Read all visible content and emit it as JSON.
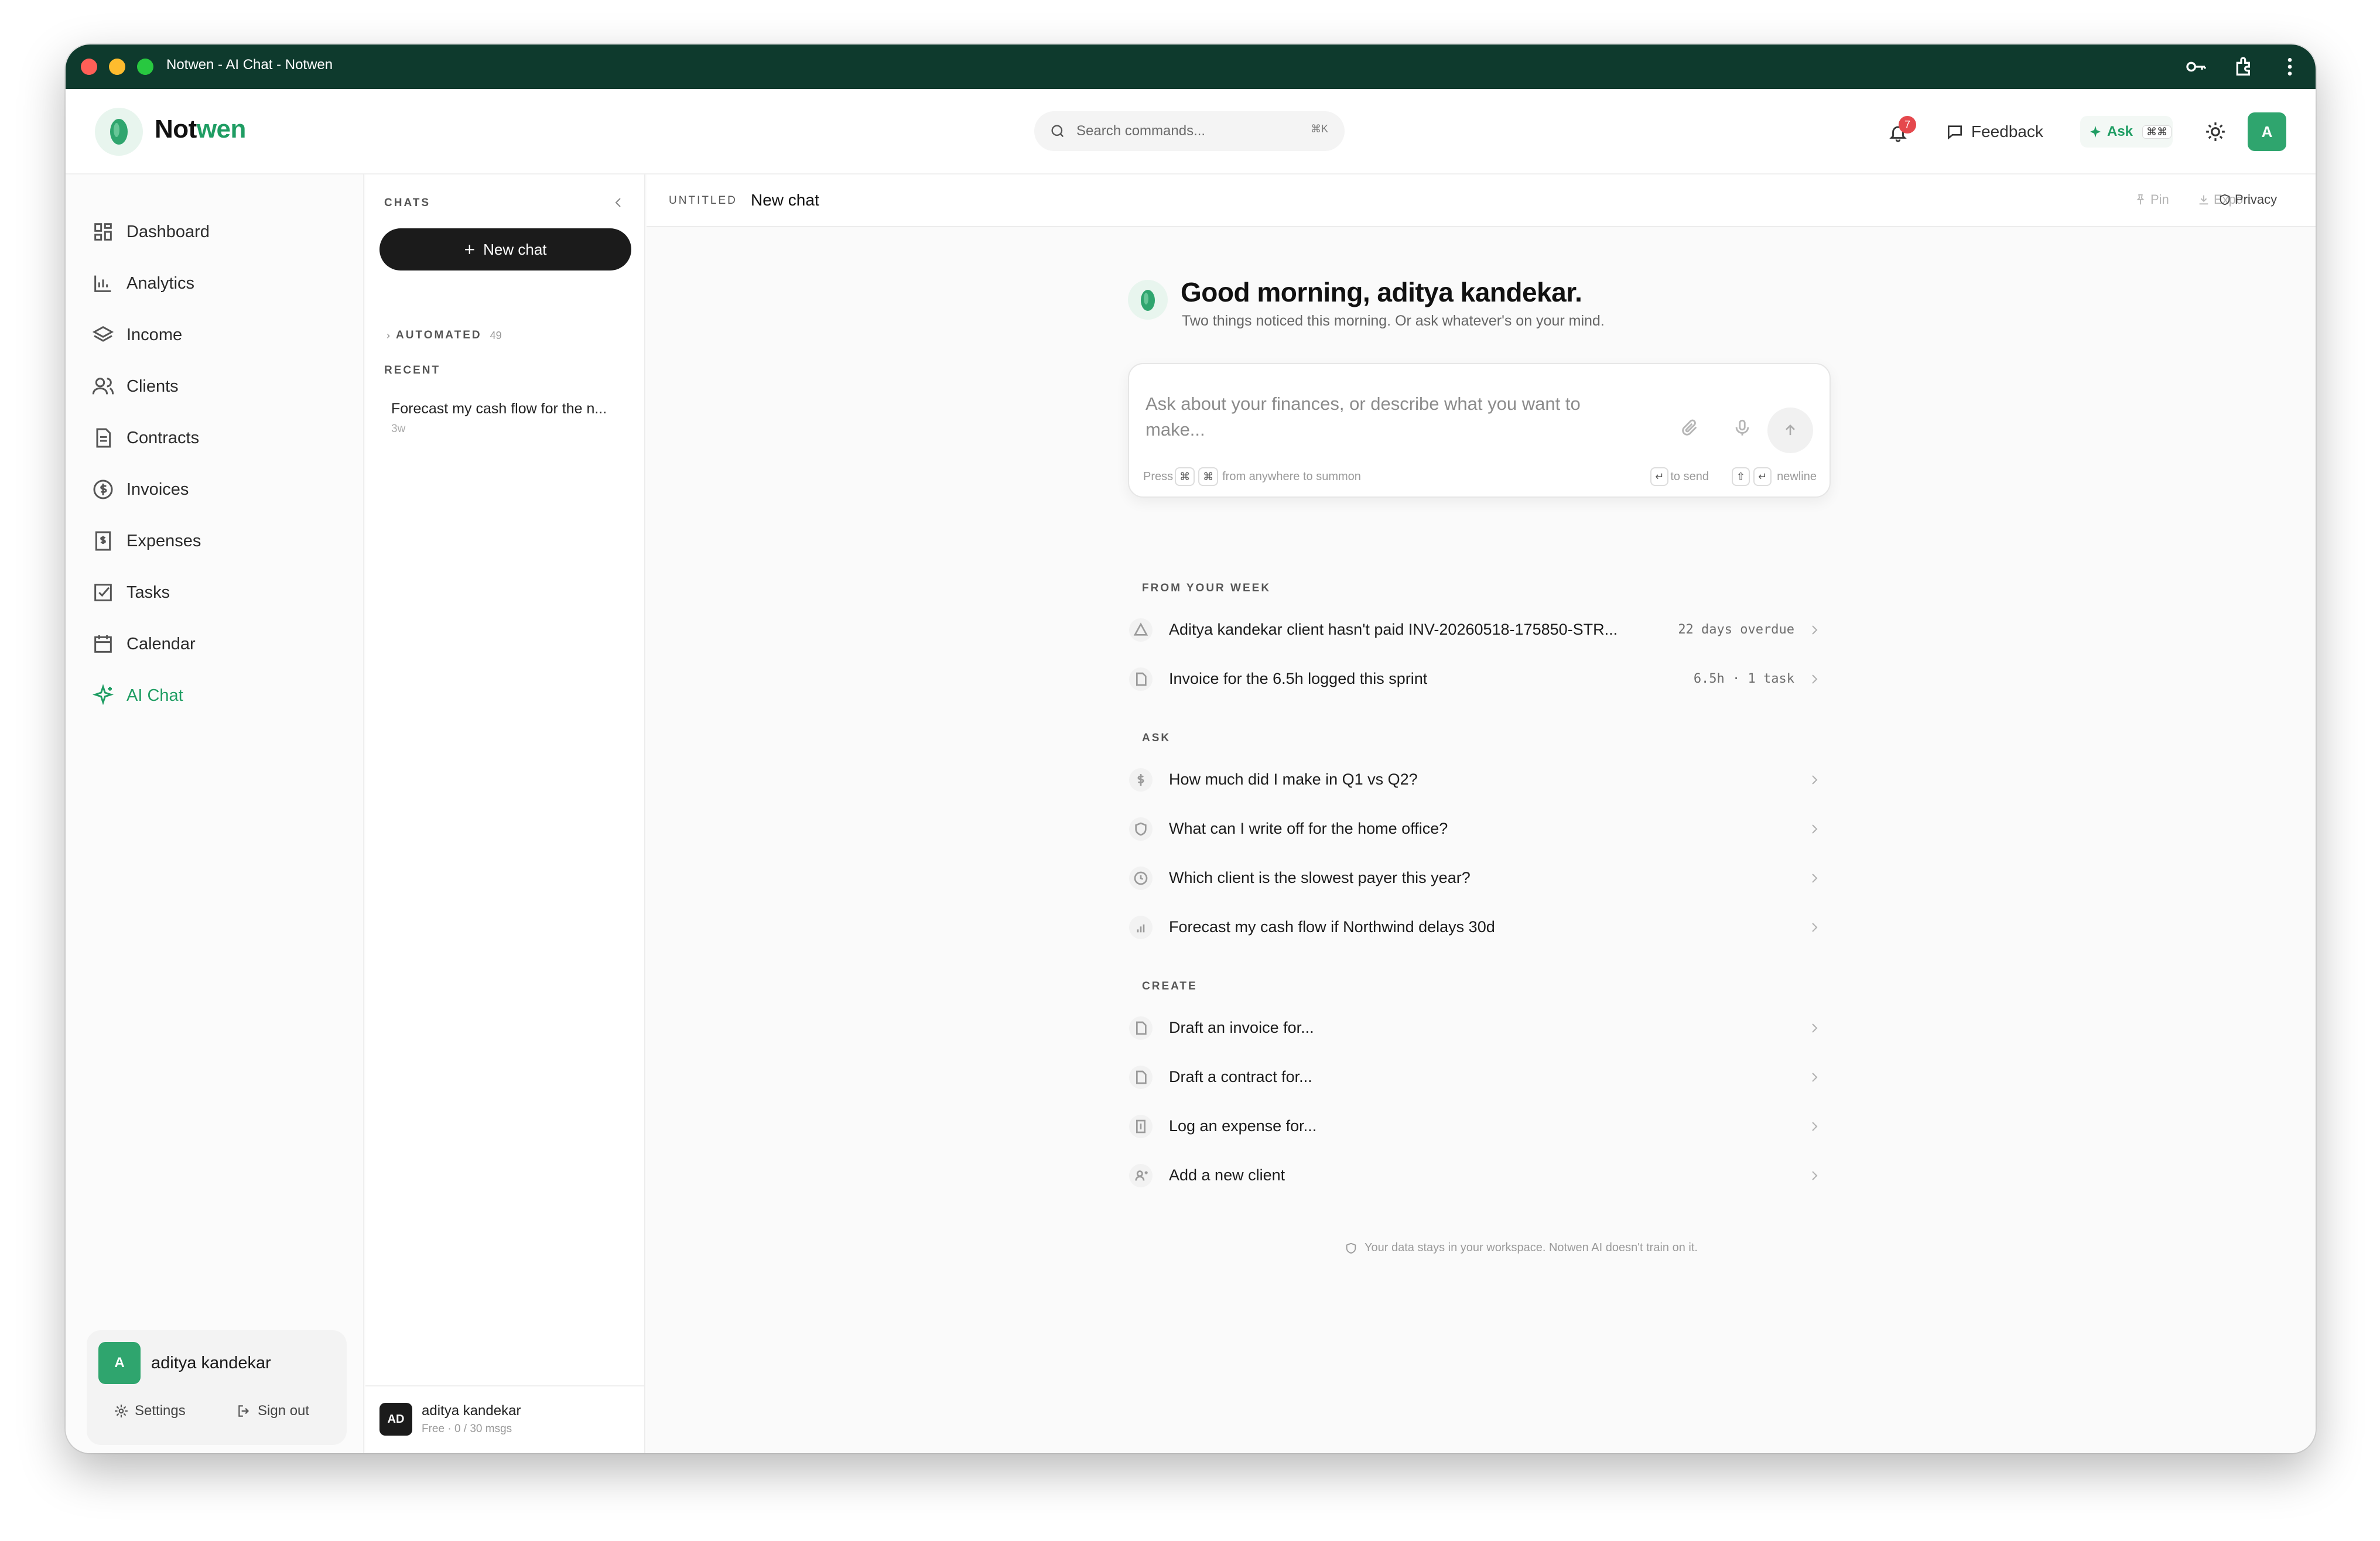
{
  "window": {
    "title": "Notwen - AI Chat - Notwen"
  },
  "header": {
    "brand_a": "Not",
    "brand_b": "wen",
    "search_placeholder": "Search commands...",
    "search_shortcut": "⌘K",
    "notification_count": "7",
    "feedback_label": "Feedback",
    "ask_label": "Ask",
    "ask_shortcut": "⌘⌘",
    "avatar_initial": "A"
  },
  "sidebar": {
    "items": [
      {
        "label": "Dashboard",
        "icon": "dashboard-icon"
      },
      {
        "label": "Analytics",
        "icon": "bar-chart-icon"
      },
      {
        "label": "Income",
        "icon": "layers-icon"
      },
      {
        "label": "Clients",
        "icon": "users-icon"
      },
      {
        "label": "Contracts",
        "icon": "document-icon"
      },
      {
        "label": "Invoices",
        "icon": "dollar-circle-icon"
      },
      {
        "label": "Expenses",
        "icon": "receipt-icon"
      },
      {
        "label": "Tasks",
        "icon": "checkbox-icon"
      },
      {
        "label": "Calendar",
        "icon": "calendar-icon"
      },
      {
        "label": "AI Chat",
        "icon": "sparkle-icon",
        "active": true
      }
    ],
    "user": {
      "initial": "A",
      "name": "aditya kandekar",
      "settings_label": "Settings",
      "signout_label": "Sign out"
    }
  },
  "chats": {
    "caption": "CHATS",
    "new_chat_label": "New chat",
    "automated_label": "AUTOMATED",
    "automated_count": "49",
    "recent_label": "RECENT",
    "recent": [
      {
        "title": "Forecast my cash flow for the n...",
        "age": "3w"
      }
    ],
    "footer": {
      "initials": "AD",
      "name": "aditya kandekar",
      "plan": "Free · 0 / 30 msgs"
    }
  },
  "main": {
    "top": {
      "tag": "UNTITLED",
      "title": "New chat",
      "pin_label": "Pin",
      "export_label": "Export",
      "privacy_label": "Privacy"
    },
    "greeting": "Good morning, aditya kandekar.",
    "subtitle": "Two things noticed this morning. Or ask whatever's on your mind.",
    "composer": {
      "placeholder_line1": "Ask about your finances, or describe what you want to",
      "placeholder_line2": "make...",
      "hint_press": "Press",
      "hint_summon": "from anywhere to summon",
      "hint_send": "to send",
      "hint_newline": "newline"
    },
    "sections": {
      "week": {
        "label": "FROM YOUR WEEK",
        "items": [
          {
            "text": "Aditya kandekar client hasn't paid INV-20260518-175850-STR...",
            "meta": "22 days overdue",
            "icon": "warning-icon"
          },
          {
            "text": "Invoice for the 6.5h logged this sprint",
            "meta": "6.5h · 1 task",
            "icon": "document-icon"
          }
        ]
      },
      "ask": {
        "label": "ASK",
        "items": [
          {
            "text": "How much did I make in Q1 vs Q2?",
            "icon": "dollar-icon"
          },
          {
            "text": "What can I write off for the home office?",
            "icon": "shield-icon"
          },
          {
            "text": "Which client is the slowest payer this year?",
            "icon": "clock-icon"
          },
          {
            "text": "Forecast my cash flow if Northwind delays 30d",
            "icon": "bar-chart-icon"
          }
        ]
      },
      "create": {
        "label": "CREATE",
        "items": [
          {
            "text": "Draft an invoice for...",
            "icon": "document-icon"
          },
          {
            "text": "Draft a contract for...",
            "icon": "document-icon"
          },
          {
            "text": "Log an expense for...",
            "icon": "receipt-icon"
          },
          {
            "text": "Add a new client",
            "icon": "user-plus-icon"
          }
        ]
      }
    },
    "footer_note": "Your data stays in your workspace. Notwen AI doesn't train on it."
  }
}
